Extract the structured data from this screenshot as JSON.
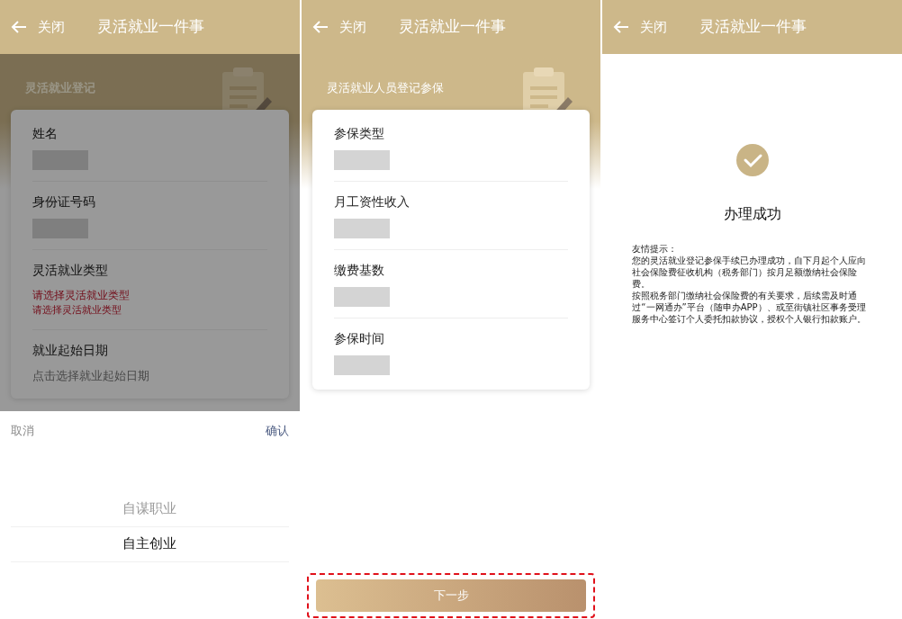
{
  "screens": [
    {
      "header": {
        "back": "关闭",
        "title": "灵活就业一件事"
      },
      "subtitle": "灵活就业登记",
      "dimmed": true,
      "fields": [
        {
          "label": "姓名",
          "kind": "redacted"
        },
        {
          "label": "身份证号码",
          "kind": "redacted"
        },
        {
          "label": "灵活就业类型",
          "kind": "error",
          "messages": [
            "请选择灵活就业类型",
            "请选择灵活就业类型"
          ]
        },
        {
          "label": "就业起始日期",
          "kind": "placeholder",
          "placeholder": "点击选择就业起始日期"
        }
      ],
      "picker": {
        "cancel": "取消",
        "confirm": "确认",
        "options": [
          {
            "label": "自谋职业",
            "selected": false
          },
          {
            "label": "自主创业",
            "selected": true
          }
        ]
      }
    },
    {
      "header": {
        "back": "关闭",
        "title": "灵活就业一件事"
      },
      "subtitle": "灵活就业人员登记参保",
      "fields": [
        {
          "label": "参保类型",
          "kind": "redacted"
        },
        {
          "label": "月工资性收入",
          "kind": "redacted"
        },
        {
          "label": "缴费基数",
          "kind": "redacted"
        },
        {
          "label": "参保时间",
          "kind": "redacted"
        }
      ],
      "next_button": {
        "label": "下一步",
        "highlighted": true
      }
    },
    {
      "header": {
        "back": "关闭",
        "title": "灵活就业一件事"
      },
      "result": {
        "title": "办理成功",
        "tip_heading": "友情提示：",
        "paragraphs": [
          "您的灵活就业登记参保手续已办理成功，自下月起个人应向社会保险费征收机构（税务部门）按月足额缴纳社会保险费。",
          "按照税务部门缴纳社会保险费的有关要求，后续需及时通过“一网通办”平台（随申办APP）、或至街镇社区事务受理服务中心签订个人委托扣款协议，授权个人银行扣款账户。"
        ]
      }
    }
  ]
}
